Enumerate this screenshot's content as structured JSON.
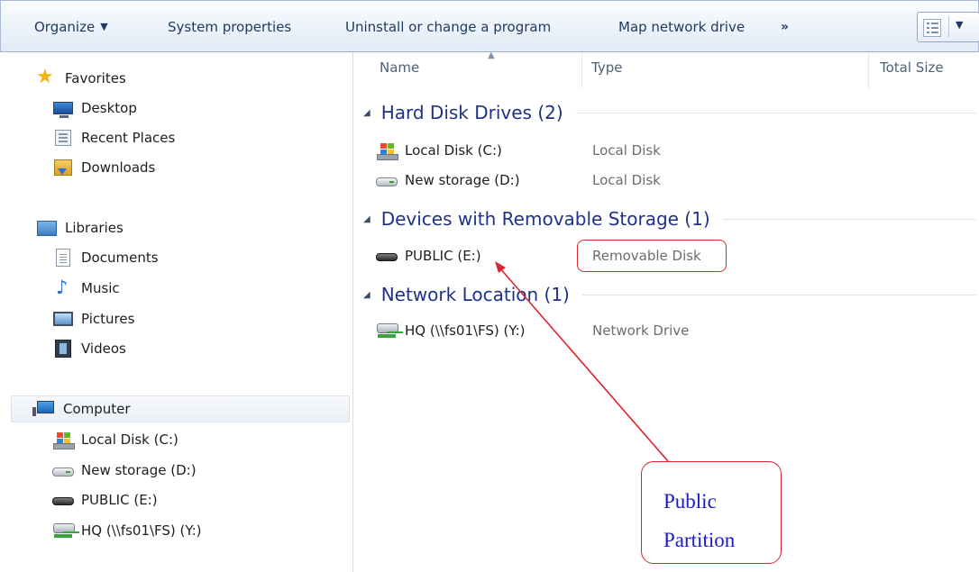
{
  "toolbar": {
    "organize": "Organize",
    "system_properties": "System properties",
    "uninstall": "Uninstall or change a program",
    "map_network_drive": "Map network drive",
    "more": "»"
  },
  "nav": {
    "favorites": {
      "label": "Favorites",
      "items": [
        "Desktop",
        "Recent Places",
        "Downloads"
      ]
    },
    "libraries": {
      "label": "Libraries",
      "items": [
        "Documents",
        "Music",
        "Pictures",
        "Videos"
      ]
    },
    "computer": {
      "label": "Computer",
      "items": [
        "Local Disk (C:)",
        "New storage (D:)",
        "PUBLIC (E:)",
        "HQ (\\\\fs01\\FS) (Y:)"
      ]
    }
  },
  "columns": {
    "name": "Name",
    "type": "Type",
    "total_size": "Total Size"
  },
  "groups": [
    {
      "title": "Hard Disk Drives (2)",
      "rows": [
        {
          "name": "Local Disk (C:)",
          "type": "Local Disk"
        },
        {
          "name": "New storage (D:)",
          "type": "Local Disk"
        }
      ]
    },
    {
      "title": "Devices with Removable Storage (1)",
      "rows": [
        {
          "name": "PUBLIC (E:)",
          "type": "Removable Disk"
        }
      ]
    },
    {
      "title": "Network Location (1)",
      "rows": [
        {
          "name": "HQ (\\\\fs01\\FS) (Y:)",
          "type": "Network Drive"
        }
      ]
    }
  ],
  "callout": {
    "line1": "Public",
    "line2": "Partition"
  },
  "colors": {
    "annotation": "#d9262c",
    "callout_text": "#1a1acd",
    "group_header": "#1e3287"
  }
}
